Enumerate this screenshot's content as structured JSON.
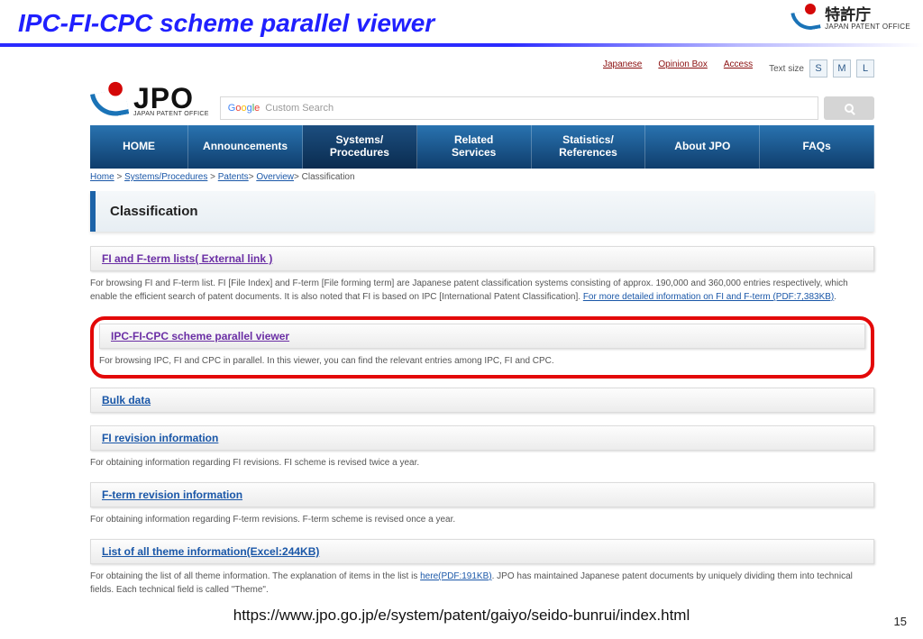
{
  "slide": {
    "title": "IPC-FI-CPC scheme parallel viewer",
    "footer_url": "https://www.jpo.go.jp/e/system/patent/gaiyo/seido-bunrui/index.html",
    "page_number": "15"
  },
  "org_logo": {
    "kanji": "特許庁",
    "sub": "JAPAN PATENT OFFICE"
  },
  "top_links": {
    "japanese": "Japanese",
    "opinion": "Opinion Box",
    "access": "Access",
    "text_size_label": "Text size",
    "s": "S",
    "m": "M",
    "l": "L"
  },
  "jpo": {
    "big": "JPO",
    "small": "JAPAN PATENT OFFICE"
  },
  "search": {
    "google_label": "Google",
    "placeholder": "Custom Search"
  },
  "nav": {
    "home": "HOME",
    "announcements": "Announcements",
    "systems": "Systems/\nProcedures",
    "related": "Related\nServices",
    "statistics": "Statistics/\nReferences",
    "about": "About JPO",
    "faqs": "FAQs"
  },
  "crumbs": {
    "home": "Home",
    "sp": "Systems/Procedures",
    "patents": "Patents",
    "overview": "Overview",
    "current": "Classification"
  },
  "page_heading": "Classification",
  "sections": {
    "fi_fterm": {
      "title": "FI and F-term lists( External link )",
      "desc_a": "For browsing FI and F-term list. FI [File Index] and F-term [File forming term] are Japanese patent classification systems consisting of approx. 190,000 and 360,000 entries respectively, which enable the efficient search of patent documents. It is also noted that FI is based on IPC [International Patent Classification]. ",
      "desc_link": "For more detailed information on FI and F-term (PDF:7,383KB)",
      "desc_b": "."
    },
    "viewer": {
      "title": "IPC-FI-CPC scheme parallel viewer",
      "desc": "For browsing IPC, FI and CPC in parallel. In this viewer, you can find the relevant entries among IPC, FI and CPC."
    },
    "bulk": {
      "title": "Bulk data"
    },
    "fi_rev": {
      "title": "FI revision information",
      "desc": "For obtaining information regarding FI revisions. FI scheme is revised twice a year."
    },
    "fterm_rev": {
      "title": "F-term revision information",
      "desc": "For obtaining information regarding F-term revisions. F-term scheme is revised once a year."
    },
    "themes": {
      "title": "List of all theme information(Excel:244KB)",
      "desc_a": "For obtaining the list of all theme information. The explanation of items in the list is ",
      "desc_link": "here(PDF:191KB)",
      "desc_b": ". JPO has maintained Japanese patent documents by uniquely dividing them into technical fields. Each technical field is called \"Theme\"."
    }
  }
}
